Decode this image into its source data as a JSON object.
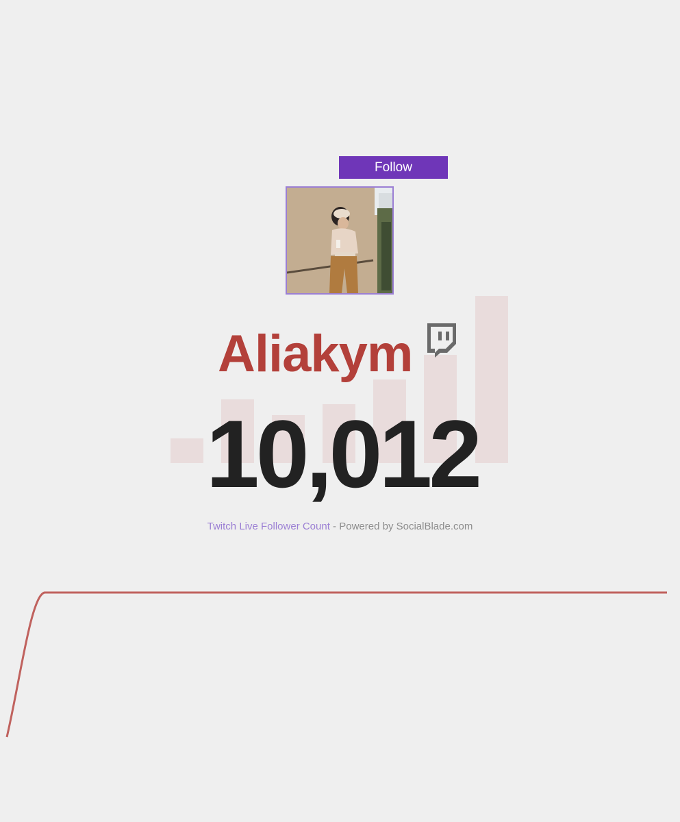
{
  "header": {
    "follow_label": "Follow"
  },
  "profile": {
    "avatar_icon": "profile-photo",
    "channel_name": "Aliakym",
    "platform_icon": "twitch-icon",
    "brand_color": "#6f36b8",
    "name_color": "#b3403a"
  },
  "counter": {
    "follower_count": "10,012"
  },
  "footer": {
    "link_text": "Twitch Live Follower Count",
    "separator": " - ",
    "powered_text": "Powered by SocialBlade.com"
  },
  "graph": {
    "line_color": "#c0625e"
  }
}
